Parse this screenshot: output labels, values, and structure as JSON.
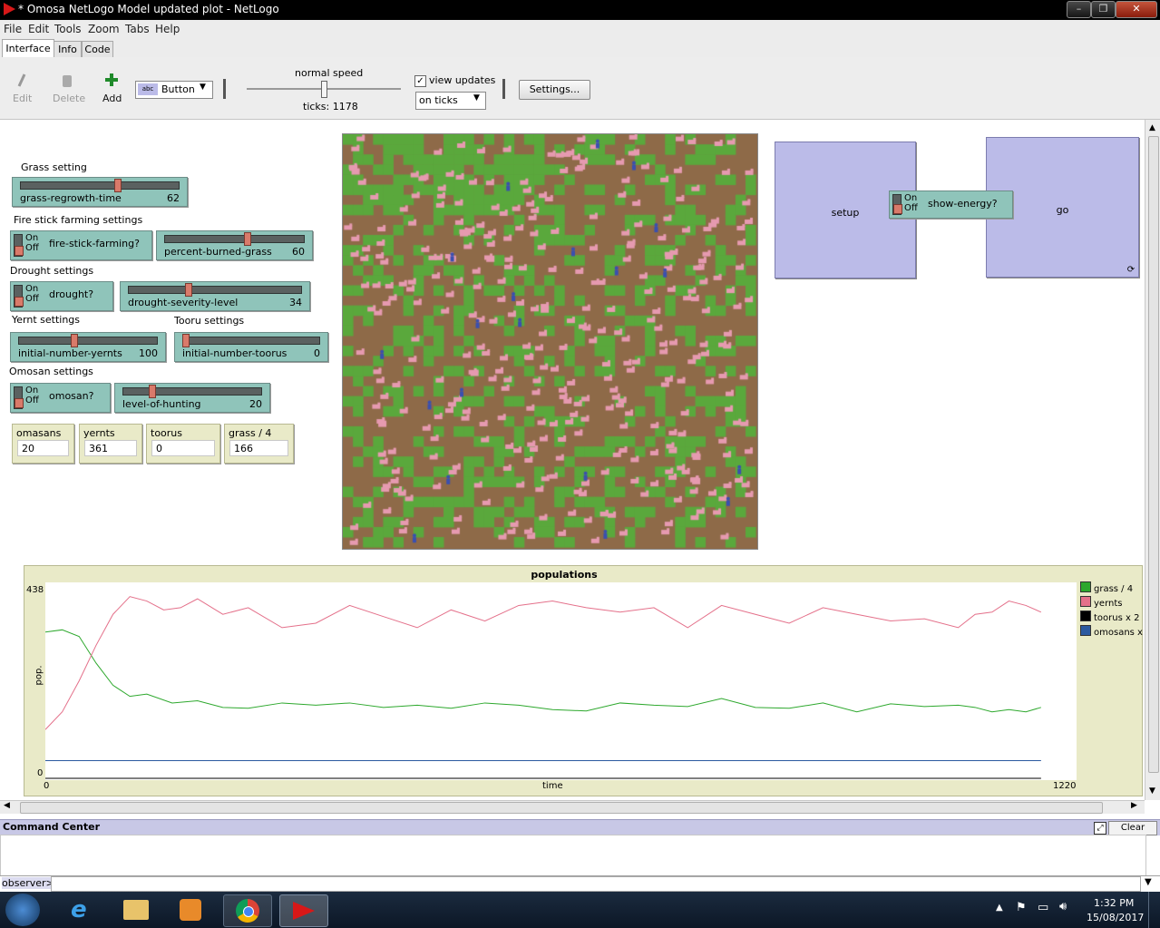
{
  "window": {
    "title": "* Omosa NetLogo Model updated plot - NetLogo",
    "controls": [
      "–",
      "❐",
      "✕"
    ]
  },
  "menu": [
    "File",
    "Edit",
    "Tools",
    "Zoom",
    "Tabs",
    "Help"
  ],
  "tabs": [
    "Interface",
    "Info",
    "Code"
  ],
  "toolbar": {
    "edit": "Edit",
    "delete": "Delete",
    "add": "Add",
    "widget_type": "Button",
    "speed_label": "normal speed",
    "ticks_label": "ticks: 1178",
    "view_updates": "view updates",
    "view_updates_checked": true,
    "update_mode": "on ticks",
    "settings": "Settings...",
    "speed_fraction": 0.5
  },
  "widgets": {
    "grass_setting_label": "Grass setting",
    "grass_regrowth": {
      "name": "grass-regrowth-time",
      "value": "62",
      "fraction": 0.62
    },
    "fire_label": "Fire stick farming settings",
    "fire_switch": {
      "name": "fire-stick-farming?",
      "on": "On",
      "off": "Off"
    },
    "percent_burned": {
      "name": "percent-burned-grass",
      "value": "60",
      "fraction": 0.6
    },
    "drought_label": "Drought settings",
    "drought_switch": {
      "name": "drought?",
      "on": "On",
      "off": "Off"
    },
    "drought_severity": {
      "name": "drought-severity-level",
      "value": "34",
      "fraction": 0.34
    },
    "yernt_label": "Yernt settings",
    "tooru_label": "Tooru settings",
    "initial_yernts": {
      "name": "initial-number-yernts",
      "value": "100",
      "fraction": 0.4
    },
    "initial_toorus": {
      "name": "initial-number-toorus",
      "value": "0",
      "fraction": 0.0
    },
    "omosan_label": "Omosan settings",
    "omosan_switch": {
      "name": "omosan?",
      "on": "On",
      "off": "Off"
    },
    "level_hunting": {
      "name": "level-of-hunting",
      "value": "20",
      "fraction": 0.2
    },
    "monitors": [
      {
        "name": "omasans",
        "value": "20"
      },
      {
        "name": "yernts",
        "value": "361"
      },
      {
        "name": "toorus",
        "value": "0"
      },
      {
        "name": "grass / 4",
        "value": "166"
      }
    ],
    "setup_button": "setup",
    "go_button": "go",
    "show_energy": {
      "name": "show-energy?",
      "on": "On",
      "off": "Off"
    }
  },
  "plot": {
    "title": "populations",
    "ylabel": "pop.",
    "xlabel": "time",
    "ymax_label": "438",
    "ymin_label": "0",
    "xmin_label": "0",
    "xmax_label": "1220"
  },
  "chart_data": {
    "type": "line",
    "title": "populations",
    "xlabel": "time",
    "ylabel": "pop.",
    "xlim": [
      0,
      1220
    ],
    "ylim": [
      0,
      438
    ],
    "series": [
      {
        "name": "grass / 4",
        "color": "#2da82d",
        "x": [
          0,
          20,
          40,
          60,
          80,
          100,
          120,
          150,
          180,
          210,
          240,
          280,
          320,
          360,
          400,
          440,
          480,
          520,
          560,
          600,
          640,
          680,
          720,
          760,
          800,
          840,
          880,
          920,
          960,
          1000,
          1040,
          1080,
          1100,
          1120,
          1140,
          1160,
          1178
        ],
        "y": [
          330,
          335,
          320,
          260,
          210,
          185,
          190,
          170,
          175,
          160,
          158,
          170,
          165,
          170,
          160,
          165,
          158,
          170,
          165,
          155,
          152,
          170,
          165,
          162,
          180,
          160,
          158,
          170,
          150,
          168,
          162,
          165,
          160,
          150,
          155,
          150,
          160
        ]
      },
      {
        "name": "yernts",
        "color": "#e4708a",
        "x": [
          0,
          20,
          40,
          60,
          80,
          100,
          120,
          140,
          160,
          180,
          210,
          240,
          280,
          320,
          360,
          400,
          440,
          480,
          520,
          560,
          600,
          640,
          680,
          720,
          760,
          800,
          840,
          880,
          920,
          960,
          1000,
          1040,
          1080,
          1100,
          1120,
          1140,
          1160,
          1178
        ],
        "y": [
          110,
          150,
          220,
          300,
          370,
          410,
          400,
          380,
          385,
          405,
          370,
          385,
          340,
          350,
          390,
          365,
          340,
          380,
          355,
          390,
          400,
          385,
          375,
          385,
          340,
          390,
          370,
          350,
          385,
          370,
          355,
          360,
          340,
          370,
          375,
          400,
          390,
          375
        ]
      },
      {
        "name": "toorus x 2",
        "color": "#000000",
        "x": [
          0,
          1178
        ],
        "y": [
          0,
          0
        ]
      },
      {
        "name": "omosans x",
        "color": "#2c5aa0",
        "x": [
          0,
          1178
        ],
        "y": [
          40,
          40
        ]
      }
    ]
  },
  "legend": [
    {
      "name": "grass / 4",
      "color": "#2da82d"
    },
    {
      "name": "yernts",
      "color": "#e4708a"
    },
    {
      "name": "toorus x 2",
      "color": "#000000"
    },
    {
      "name": "omosans x",
      "color": "#2c5aa0"
    }
  ],
  "command_center": {
    "title": "Command Center",
    "clear": "Clear",
    "prompt": "observer>"
  },
  "taskbar": {
    "time": "1:32 PM",
    "date": "15/08/2017"
  }
}
